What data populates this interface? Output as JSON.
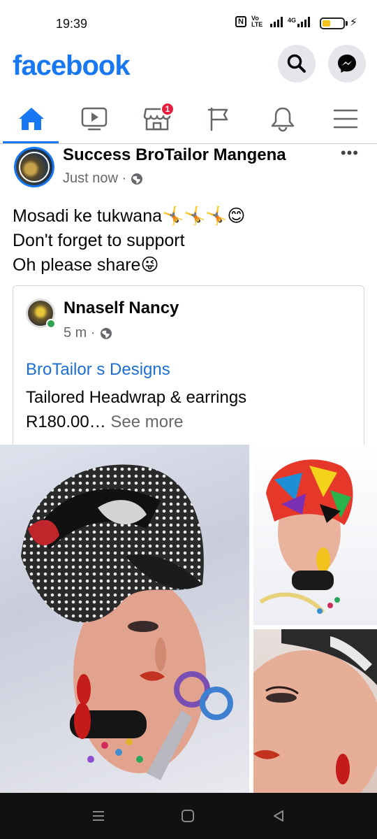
{
  "status_bar": {
    "time": "19:39",
    "network_labels": [
      "N",
      "Vo LTE",
      "4G"
    ],
    "battery_level": 0.3
  },
  "header": {
    "logo": "facebook",
    "brand_color": "#1877f2",
    "search_icon": "search-icon",
    "messenger_icon": "messenger-icon"
  },
  "nav": {
    "tabs": [
      {
        "icon": "home-icon",
        "active": true
      },
      {
        "icon": "watch-icon",
        "active": false
      },
      {
        "icon": "marketplace-icon",
        "active": false,
        "badge": "1"
      },
      {
        "icon": "pages-flag-icon",
        "active": false
      },
      {
        "icon": "notifications-bell-icon",
        "active": false
      },
      {
        "icon": "menu-icon",
        "active": false
      }
    ]
  },
  "post": {
    "author": "Success BroTailor Mangena",
    "time": "Just now ·",
    "privacy_icon": "globe-icon",
    "text_lines": [
      "Mosadi ke tukwana🤸🤸🤸😊",
      "Don't forget to support",
      "Oh please share😜"
    ],
    "shared": {
      "author": "Nnaself Nancy",
      "time": "5 m ·",
      "link": "BroTailor s Designs",
      "line1": "Tailored Headwrap & earrings",
      "line2": "R180.00…",
      "see_more": "See more"
    }
  },
  "system_nav": {
    "buttons": [
      "recent-apps-icon",
      "home-circle-icon",
      "back-icon"
    ]
  }
}
